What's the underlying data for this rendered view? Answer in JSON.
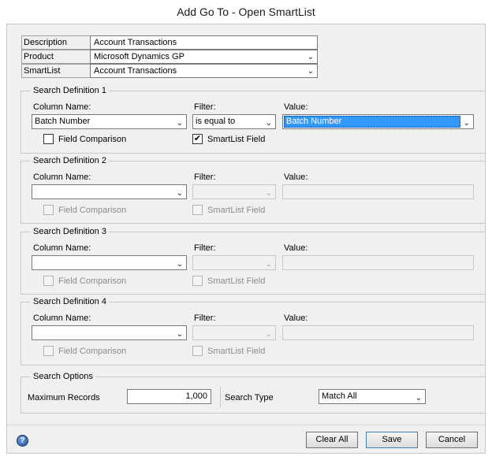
{
  "window": {
    "title": "Add Go To - Open SmartList"
  },
  "header_fields": {
    "description": {
      "label": "Description",
      "value": "Account Transactions"
    },
    "product": {
      "label": "Product",
      "value": "Microsoft Dynamics GP"
    },
    "smartlist": {
      "label": "SmartList",
      "value": "Account Transactions"
    }
  },
  "search_definitions": [
    {
      "title": "Search Definition 1",
      "column_label": "Column Name:",
      "column_value": "Batch Number",
      "filter_label": "Filter:",
      "filter_value": "is equal to",
      "value_label": "Value:",
      "value_value": "Batch Number",
      "field_comparison_label": "Field Comparison",
      "field_comparison_checked": false,
      "smartlist_field_label": "SmartList Field",
      "smartlist_field_checked": true,
      "enabled": true
    },
    {
      "title": "Search Definition 2",
      "column_label": "Column Name:",
      "column_value": "",
      "filter_label": "Filter:",
      "filter_value": "",
      "value_label": "Value:",
      "value_value": "",
      "field_comparison_label": "Field Comparison",
      "field_comparison_checked": false,
      "smartlist_field_label": "SmartList Field",
      "smartlist_field_checked": false,
      "enabled": false
    },
    {
      "title": "Search Definition 3",
      "column_label": "Column Name:",
      "column_value": "",
      "filter_label": "Filter:",
      "filter_value": "",
      "value_label": "Value:",
      "value_value": "",
      "field_comparison_label": "Field Comparison",
      "field_comparison_checked": false,
      "smartlist_field_label": "SmartList Field",
      "smartlist_field_checked": false,
      "enabled": false
    },
    {
      "title": "Search Definition 4",
      "column_label": "Column Name:",
      "column_value": "",
      "filter_label": "Filter:",
      "filter_value": "",
      "value_label": "Value:",
      "value_value": "",
      "field_comparison_label": "Field Comparison",
      "field_comparison_checked": false,
      "smartlist_field_label": "SmartList Field",
      "smartlist_field_checked": false,
      "enabled": false
    }
  ],
  "search_options": {
    "title": "Search Options",
    "max_records_label": "Maximum Records",
    "max_records_value": "1,000",
    "search_type_label": "Search Type",
    "search_type_value": "Match All"
  },
  "buttons": {
    "clear_all": "Clear All",
    "save": "Save",
    "cancel": "Cancel"
  },
  "icons": {
    "help": "help-icon",
    "check": "✔",
    "chevron": "⌄"
  },
  "colors": {
    "selection": "#3399ff",
    "window_background": "#f0f0f0"
  }
}
